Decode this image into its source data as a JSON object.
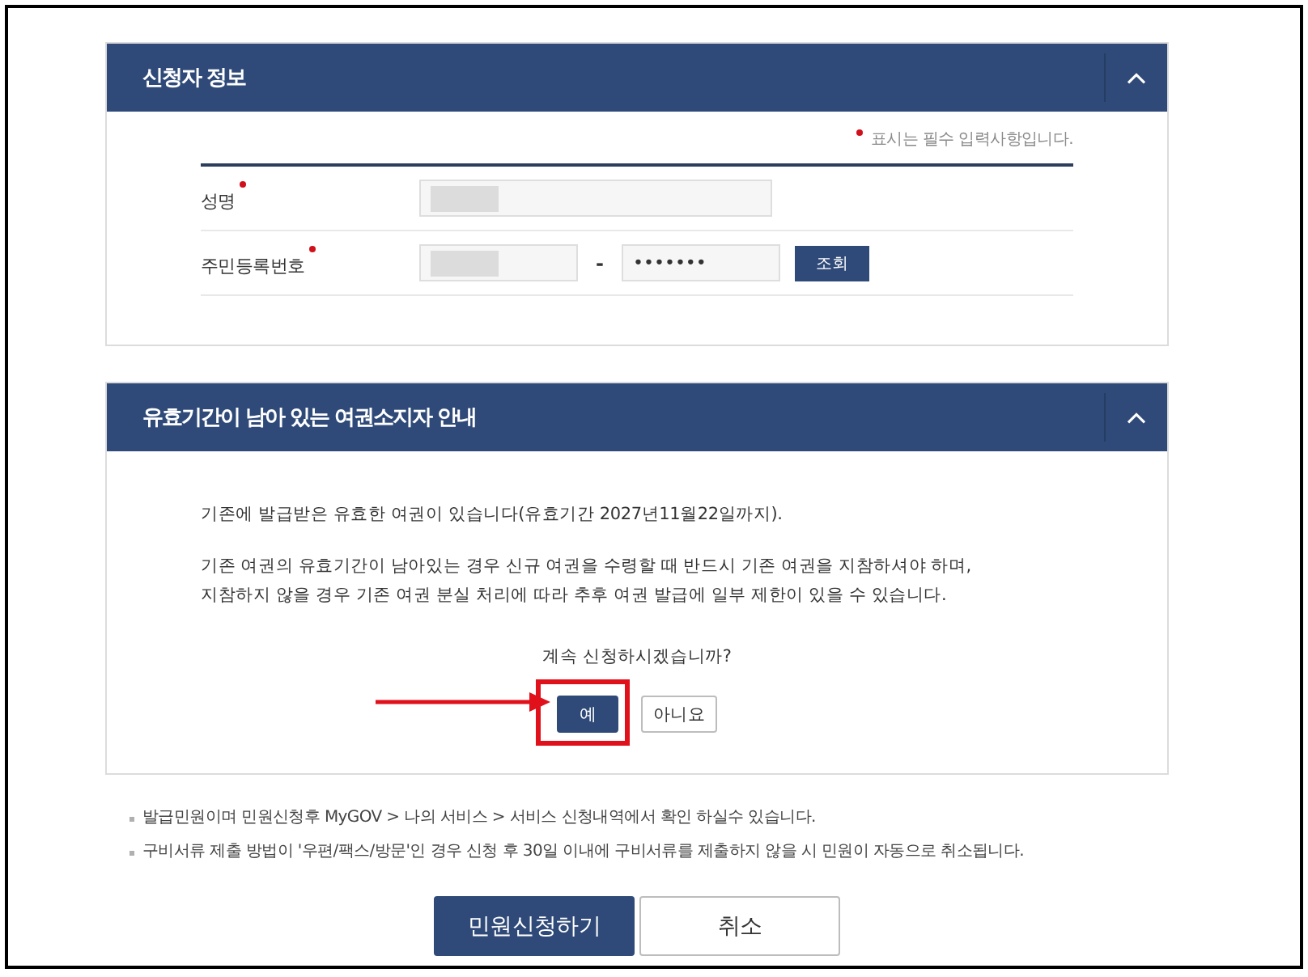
{
  "sections": [
    {
      "kind": "applicant",
      "title": "신청자 정보",
      "expanded": true,
      "required_note": "표시는 필수 입력사항입니다.",
      "fields": [
        {
          "label": "성명",
          "required": true,
          "inputs": [
            {
              "redacted": true
            }
          ]
        },
        {
          "label": "주민등록번호",
          "required": true,
          "inputs": [
            {
              "redacted": true
            },
            {
              "value": "•••••••"
            }
          ],
          "separator": "-",
          "button": "조회"
        }
      ]
    },
    {
      "kind": "notice",
      "title": "유효기간이 남아 있는 여권소지자 안내",
      "expanded": true,
      "paragraphs": [
        "기존에 발급받은 유효한 여권이 있습니다(유효기간 2027년11월22일까지).",
        "기존 여권의 유효기간이 남아있는 경우 신규 여권을 수령할 때 반드시 기존 여권을 지참하셔야 하며,\n지참하지 않을 경우 기존 여권 분실 처리에 따라 추후 여권 발급에 일부 제한이 있을 수 있습니다."
      ],
      "question": "계속 신청하시겠습니까?",
      "buttons": [
        {
          "label": "예",
          "kind": "primary",
          "highlighted": true
        },
        {
          "label": "아니요",
          "kind": "secondary",
          "highlighted": false
        }
      ]
    }
  ],
  "notes": [
    "발급민원이며 민원신청후 MyGOV > 나의 서비스 > 서비스 신청내역에서 확인 하실수 있습니다.",
    "구비서류 제출 방법이 '우편/팩스/방문'인 경우 신청 후 30일 이내에 구비서류를 제출하지 않을 시 민원이 자동으로 취소됩니다."
  ],
  "actions": [
    {
      "label": "민원신청하기",
      "kind": "primary"
    },
    {
      "label": "취소",
      "kind": "secondary"
    }
  ]
}
